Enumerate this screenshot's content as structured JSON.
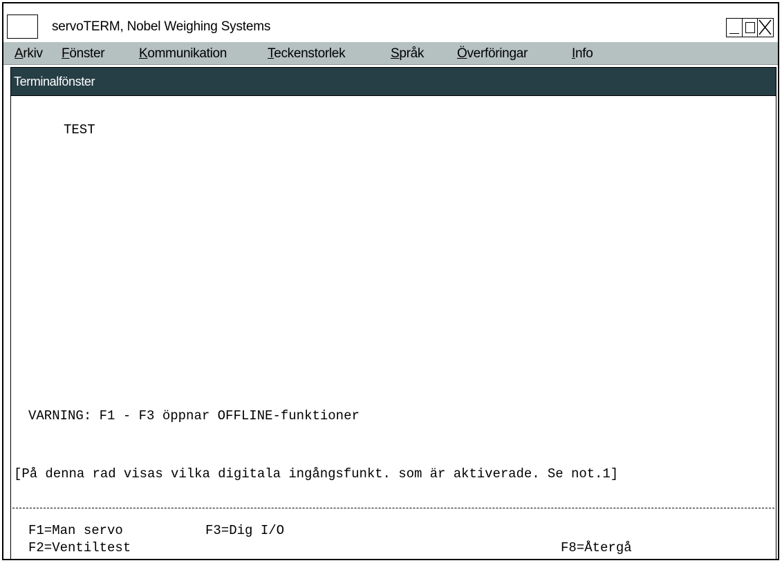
{
  "window": {
    "title": "servoTERM, Nobel Weighing Systems"
  },
  "menu": [
    {
      "accel": "A",
      "rest": "rkiv"
    },
    {
      "accel": "F",
      "rest": "önster"
    },
    {
      "accel": "K",
      "rest": "ommunikation"
    },
    {
      "accel": "T",
      "rest": "eckenstorlek"
    },
    {
      "accel": "S",
      "rest": "pråk"
    },
    {
      "accel": "Ö",
      "rest": "verföringar"
    },
    {
      "accel": "I",
      "rest": "nfo"
    }
  ],
  "panel": {
    "title": "Terminalfönster"
  },
  "terminal": {
    "line_test": "TEST",
    "warning": "VARNING: F1 - F3 öppnar OFFLINE-funktioner",
    "status_line": "[På denna rad visas vilka digitala ingångsfunkt. som är aktiverade. Se not.1]",
    "fkeys": {
      "f1": "F1=Man servo",
      "f3": "F3=Dig I/O",
      "f2": "F2=Ventiltest",
      "f8": "F8=Återgå"
    }
  },
  "colors": {
    "menubar_bg": "#b5c0c0",
    "panel_title_bg": "#263e46"
  }
}
